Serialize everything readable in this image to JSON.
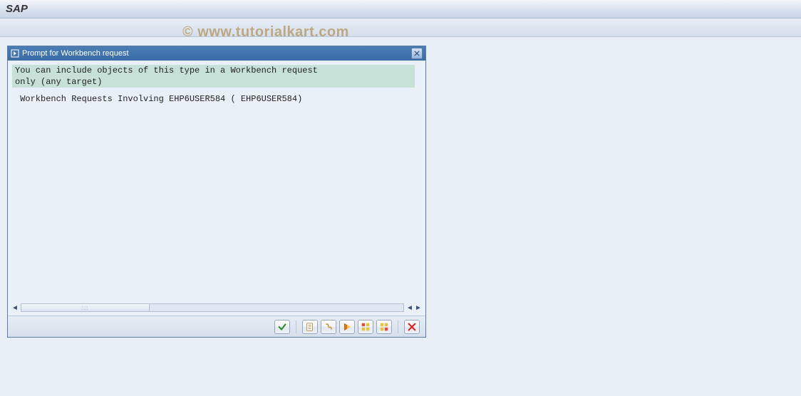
{
  "app": {
    "title": "SAP"
  },
  "dialog": {
    "title": "Prompt for Workbench request",
    "notice_line1": "You can include objects of this type in a Workbench request",
    "notice_line2": "only (any target)",
    "body_line": " Workbench Requests Involving EHP6USER584 ( EHP6USER584)"
  },
  "footer": {
    "buttons": [
      {
        "name": "ok-button",
        "icon": "check"
      },
      {
        "name": "sep"
      },
      {
        "name": "own-requests-button",
        "icon": "page"
      },
      {
        "name": "tree-button",
        "icon": "chain"
      },
      {
        "name": "execute-button",
        "icon": "play"
      },
      {
        "name": "grid-1-button",
        "icon": "grid-red"
      },
      {
        "name": "grid-2-button",
        "icon": "grid"
      },
      {
        "name": "sep"
      },
      {
        "name": "cancel-button",
        "icon": "x-red"
      }
    ]
  },
  "watermark": "© www.tutorialkart.com"
}
